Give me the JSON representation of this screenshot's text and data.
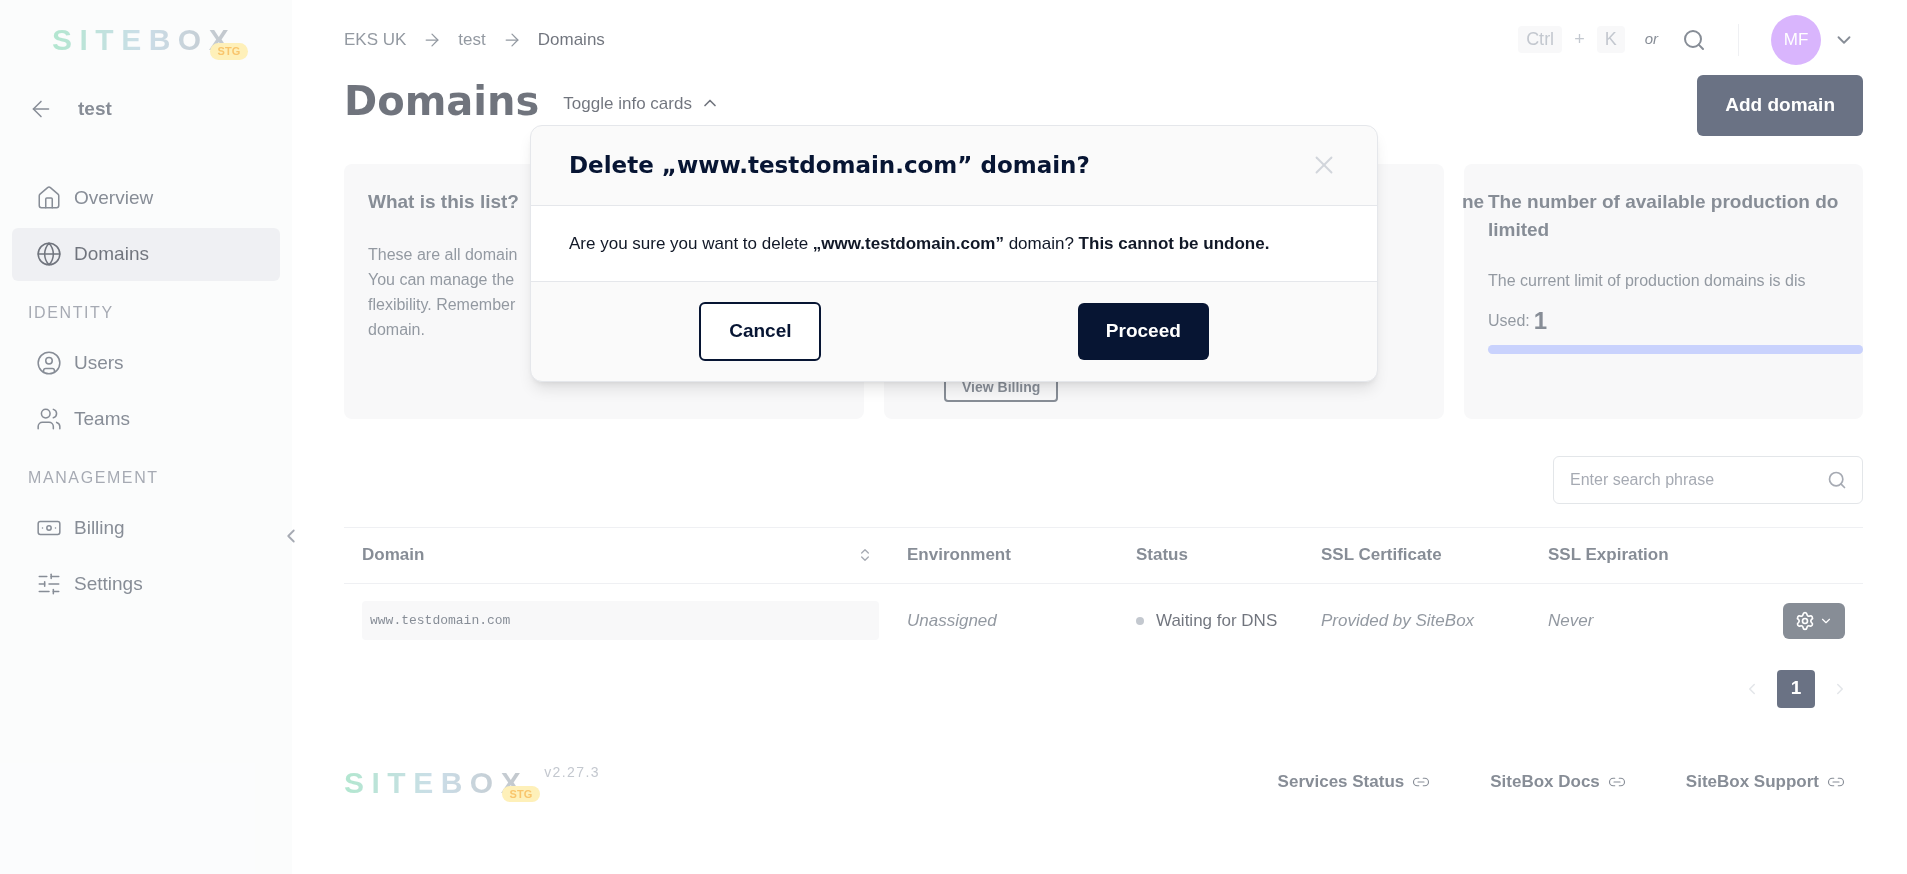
{
  "header": {
    "logo": "SITEBOX",
    "env_badge": "STG",
    "breadcrumbs": [
      "EKS UK",
      "test",
      "Domains"
    ],
    "shortcut": {
      "keys": [
        "Ctrl",
        "+",
        "K"
      ],
      "or": "or"
    },
    "avatar": "MF"
  },
  "sidebar": {
    "back": "test",
    "items": [
      {
        "label": "Overview",
        "selected": false
      },
      {
        "label": "Domains",
        "selected": true
      }
    ],
    "sections": [
      {
        "title": "IDENTITY",
        "items": [
          {
            "label": "Users",
            "selected": false
          },
          {
            "label": "Teams",
            "selected": false
          }
        ]
      },
      {
        "title": "MANAGEMENT",
        "items": [
          {
            "label": "Billing",
            "selected": false
          },
          {
            "label": "Settings",
            "selected": false
          }
        ]
      }
    ]
  },
  "page": {
    "title": "Domains",
    "toggle": "Toggle info cards",
    "add_button": "Add domain"
  },
  "cards": [
    {
      "title": "What is this list?",
      "lines": [
        "These are all domain",
        "You can manage the",
        "flexibility. Remember",
        "domain."
      ]
    },
    {
      "title": "ne",
      "button": "View Billing"
    },
    {
      "title": "The number of available production do",
      "title_2": "limited",
      "text": "The current limit of production domains is dis",
      "used_label": "Used:",
      "used_value": "1",
      "level": 1
    }
  ],
  "search": {
    "placeholder": "Enter search phrase"
  },
  "table": {
    "columns": [
      "Domain",
      "Environment",
      "Status",
      "SSL Certificate",
      "SSL Expiration"
    ],
    "rows": [
      {
        "domain": "www.testdomain.com",
        "environment": "Unassigned",
        "status": "Waiting for DNS",
        "ssl_certificate": "Provided by SiteBox",
        "ssl_expiration": "Never"
      }
    ]
  },
  "pagination": [
    {
      "label": "1",
      "selected": true
    }
  ],
  "footer": {
    "logo": "SITEBOX",
    "env_badge": "STG",
    "version": "v2.27.3",
    "links": [
      "Services Status",
      "SiteBox Docs",
      "SiteBox Support"
    ]
  },
  "dialog": {
    "title": "Delete „www.testdomain.com” domain?",
    "message": "Are you sure you want to delete **„www.testdomain.com”** domain? **This cannot be undone.**",
    "cancel": "Cancel",
    "proceed": "Proceed"
  }
}
